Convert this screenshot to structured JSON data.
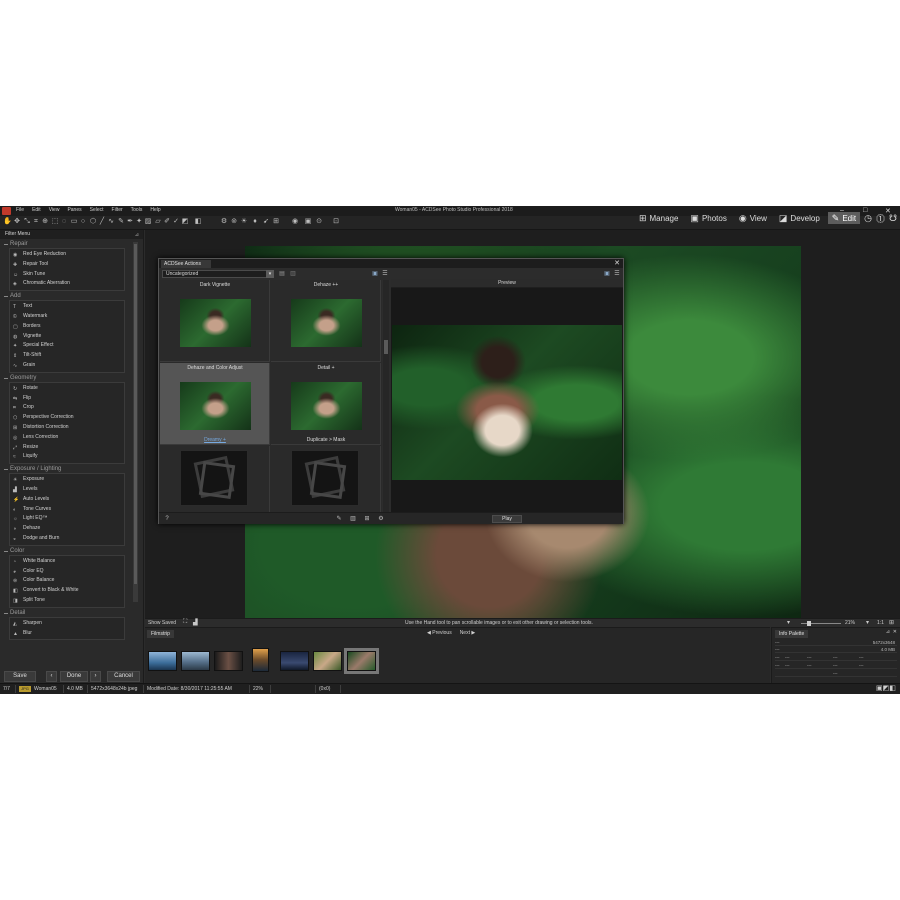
{
  "app": {
    "window_title": "Woman05 - ACDSee Photo Studio Professional 2018",
    "menu": [
      "File",
      "Edit",
      "View",
      "Panes",
      "Select",
      "Filter",
      "Tools",
      "Help"
    ],
    "modes": [
      {
        "label": "Manage",
        "icon": "grid-icon"
      },
      {
        "label": "Photos",
        "icon": "photos-icon"
      },
      {
        "label": "View",
        "icon": "eye-icon"
      },
      {
        "label": "Develop",
        "icon": "develop-icon"
      },
      {
        "label": "Edit",
        "icon": "edit-icon",
        "active": true
      }
    ]
  },
  "filter_menu": {
    "title": "Filter Menu",
    "groups": [
      {
        "title": "Repair",
        "items": [
          "Red Eye Reduction",
          "Repair Tool",
          "Skin Tune",
          "Chromatic Aberration"
        ]
      },
      {
        "title": "Add",
        "items": [
          "Text",
          "Watermark",
          "Borders",
          "Vignette",
          "Special Effect",
          "Tilt-Shift",
          "Grain"
        ]
      },
      {
        "title": "Geometry",
        "items": [
          "Rotate",
          "Flip",
          "Crop",
          "Perspective Correction",
          "Distortion Correction",
          "Lens Correction",
          "Resize",
          "Liquify"
        ]
      },
      {
        "title": "Exposure / Lighting",
        "items": [
          "Exposure",
          "Levels",
          "Auto Levels",
          "Tone Curves",
          "Light EQ™",
          "Dehaze",
          "Dodge and Burn"
        ]
      },
      {
        "title": "Color",
        "items": [
          "White Balance",
          "Color EQ",
          "Color Balance",
          "Convert to Black & White",
          "Split Tone"
        ]
      },
      {
        "title": "Detail",
        "items": [
          "Sharpen",
          "Blur"
        ]
      }
    ],
    "buttons": {
      "save": "Save",
      "done": "Done",
      "cancel": "Cancel"
    }
  },
  "actions_dialog": {
    "tab": "ACDSee Actions",
    "category": "Uncategorized",
    "actions": [
      {
        "label": "Dark Vignette",
        "label_pos": "top"
      },
      {
        "label": "Dehaze ++",
        "label_pos": "top"
      },
      {
        "label": "Dehaze and Color Adjust",
        "label_pos": "top",
        "selected": true
      },
      {
        "label": "Detail +",
        "label_pos": "top"
      },
      {
        "label": "Dreamy +",
        "label_pos": "bottom",
        "selected": true
      },
      {
        "label": "Duplicate > Mask",
        "label_pos": "bottom"
      }
    ],
    "preview_title": "Preview",
    "play_label": "Play"
  },
  "status_strip": {
    "show_saved": "Show Saved",
    "hint": "Use the Hand tool to pan scrollable images or to exit other drawing or selection tools.",
    "zoom": "21%",
    "ratio": "1:1"
  },
  "filmstrip": {
    "tab": "Filmstrip",
    "previous": "Previous",
    "next": "Next"
  },
  "info_palette": {
    "tab": "Info Palette",
    "rows": [
      {
        "left": "---",
        "right": "5472x3648"
      },
      {
        "left": "---",
        "right": "4.0 MB"
      },
      {
        "left": "---",
        "cols": [
          "---",
          "---",
          "---",
          "---"
        ]
      },
      {
        "left": "---",
        "cols": [
          "---",
          "---",
          "---",
          "---"
        ]
      },
      {
        "left": "",
        "cols": [
          "",
          "",
          "---",
          ""
        ]
      }
    ]
  },
  "bottom_bar": {
    "index": "7/7",
    "format": "JPG",
    "filename": "Woman05",
    "filesize": "4.0 MB",
    "dimensions": "5472x3648x24b jpeg",
    "modified": "Modified Date: 8/30/2017 11:25:55 AM",
    "zoom": "22%",
    "coords": "(0x0)"
  },
  "colors": {
    "accent": "#76a9e0",
    "panel": "#2b2b2b",
    "badge": "#b99b2e"
  }
}
